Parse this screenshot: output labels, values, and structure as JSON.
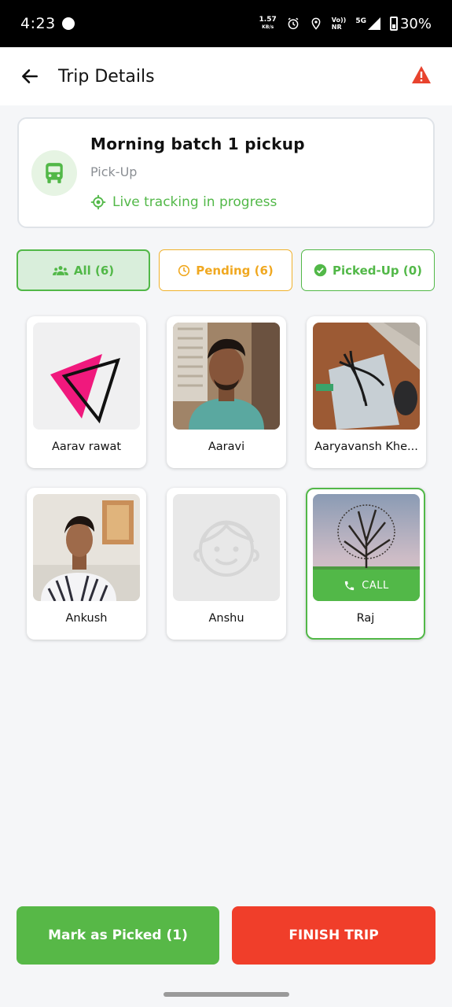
{
  "status_bar": {
    "time": "4:23",
    "speed_value": "1.57",
    "speed_unit": "KB/s",
    "network_top": "Vo))",
    "network_bottom": "NR",
    "network_type": "5G",
    "battery": "30%"
  },
  "header": {
    "title": "Trip Details",
    "back_icon": "arrow-left-icon",
    "alert_icon": "warning-triangle-icon",
    "alert_color": "#e8432e"
  },
  "trip": {
    "title": "Morning batch 1 pickup",
    "type": "Pick-Up",
    "status": "Live tracking in progress",
    "bus_icon": "bus-icon",
    "status_icon": "location-target-icon"
  },
  "filters": {
    "all": "All (6)",
    "pending": "Pending (6)",
    "picked_up": "Picked-Up (0)"
  },
  "passengers": [
    {
      "name": "Aarav rawat",
      "photo": "logo-triangle"
    },
    {
      "name": "Aaravi",
      "photo": "selfie-man-teal-shirt"
    },
    {
      "name": "Aaryavansh  Khe...",
      "photo": "desk-cables-mouse"
    },
    {
      "name": "Ankush",
      "photo": "man-striped-shirt"
    },
    {
      "name": "Anshu",
      "photo": "default-avatar"
    },
    {
      "name": "Raj",
      "photo": "tree-landscape",
      "call_label": "CALL"
    }
  ],
  "actions": {
    "mark_picked": "Mark as Picked (1)",
    "finish_trip": "FINISH TRIP"
  },
  "colors": {
    "primary_green": "#52b848",
    "pending_orange": "#f0a820",
    "danger_red": "#f03e2a"
  }
}
